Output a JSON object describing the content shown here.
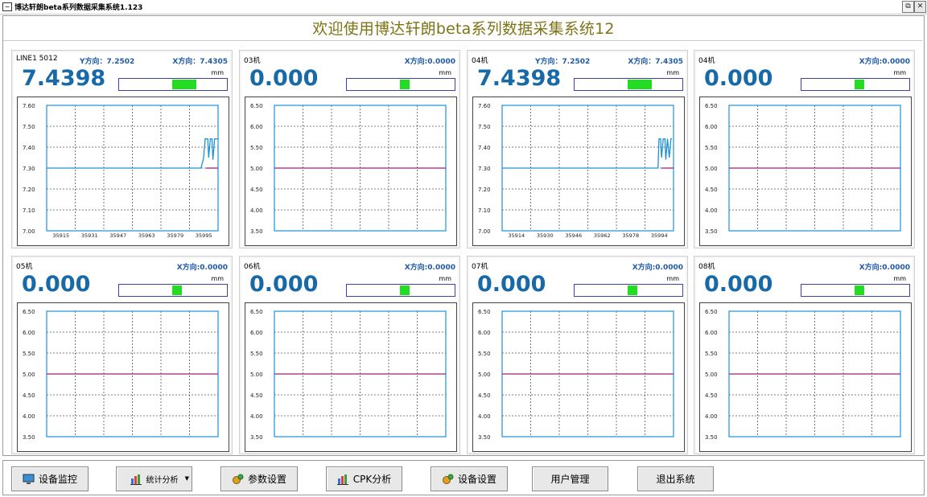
{
  "window": {
    "title": "博达轩朗beta系列数据采集系统1.123",
    "restore_glyph": "⧉",
    "close_glyph": "✕"
  },
  "header": {
    "title": "欢迎使用博达轩朗beta系列数据采集系统12"
  },
  "panels": [
    {
      "name": "LINE1  5012",
      "y_label": "Y方向：7.2502",
      "x_label": "X方向：7.4305",
      "value": "7.4398",
      "unit": "mm",
      "level_from": 0.5,
      "level_to": 0.73,
      "chart_data": {
        "type": "line",
        "y_ticks": [
          "7.60",
          "7.50",
          "7.40",
          "7.30",
          "7.20",
          "7.10",
          "7.00"
        ],
        "x_ticks": [
          "35915",
          "35931",
          "35947",
          "35963",
          "35979",
          "35995"
        ],
        "ylim": [
          7.0,
          7.6
        ],
        "series": [
          {
            "color": "#1e90d8",
            "values": [
              [
                0,
                7.3
              ],
              [
                0.9,
                7.3
              ],
              [
                0.915,
                7.345
              ],
              [
                0.925,
                7.44
              ],
              [
                0.94,
                7.44
              ],
              [
                0.945,
                7.35
              ],
              [
                0.955,
                7.44
              ],
              [
                0.965,
                7.44
              ],
              [
                0.97,
                7.34
              ],
              [
                0.98,
                7.44
              ],
              [
                1.0,
                7.44
              ]
            ]
          },
          {
            "color": "#a0207a",
            "values": [
              [
                0.93,
                7.3
              ],
              [
                1.0,
                7.3
              ]
            ]
          }
        ]
      }
    },
    {
      "name": "03机",
      "y_label": "",
      "x_label": "X方向:0.0000",
      "value": "0.000",
      "unit": "mm",
      "level_from": 0.5,
      "level_to": 0.59,
      "chart_data": {
        "type": "line",
        "y_ticks": [
          "6.50",
          "6.00",
          "5.50",
          "5.00",
          "4.50",
          "4.00",
          "3.50"
        ],
        "x_ticks": [],
        "ylim": [
          3.5,
          6.5
        ],
        "series": [
          {
            "color": "#a0207a",
            "values": [
              [
                0,
                5.0
              ],
              [
                1,
                5.0
              ]
            ]
          }
        ]
      }
    },
    {
      "name": "04机",
      "y_label": "Y方向：7.2502",
      "x_label": "X方向：7.4305",
      "value": "7.4398",
      "unit": "mm",
      "level_from": 0.5,
      "level_to": 0.73,
      "chart_data": {
        "type": "line",
        "y_ticks": [
          "7.60",
          "7.50",
          "7.40",
          "7.30",
          "7.20",
          "7.10",
          "7.00"
        ],
        "x_ticks": [
          "35914",
          "35930",
          "35946",
          "35962",
          "35978",
          "35994"
        ],
        "ylim": [
          7.0,
          7.6
        ],
        "series": [
          {
            "color": "#1e90d8",
            "values": [
              [
                0,
                7.3
              ],
              [
                0.91,
                7.3
              ],
              [
                0.915,
                7.44
              ],
              [
                0.925,
                7.44
              ],
              [
                0.93,
                7.35
              ],
              [
                0.94,
                7.44
              ],
              [
                0.95,
                7.44
              ],
              [
                0.955,
                7.34
              ],
              [
                0.965,
                7.44
              ],
              [
                0.975,
                7.35
              ],
              [
                0.985,
                7.44
              ],
              [
                0.99,
                7.44
              ]
            ]
          },
          {
            "color": "#a0207a",
            "values": [
              [
                0.93,
                7.3
              ],
              [
                1.0,
                7.3
              ]
            ]
          }
        ]
      }
    },
    {
      "name": "04机",
      "y_label": "",
      "x_label": "X方向:0.0000",
      "value": "0.000",
      "unit": "mm",
      "level_from": 0.5,
      "level_to": 0.59,
      "chart_data": {
        "type": "line",
        "y_ticks": [
          "6.50",
          "6.00",
          "5.50",
          "5.00",
          "4.50",
          "4.00",
          "3.50"
        ],
        "x_ticks": [],
        "ylim": [
          3.5,
          6.5
        ],
        "series": [
          {
            "color": "#a0207a",
            "values": [
              [
                0,
                5.0
              ],
              [
                1,
                5.0
              ]
            ]
          }
        ]
      }
    },
    {
      "name": "05机",
      "y_label": "",
      "x_label": "X方向:0.0000",
      "value": "0.000",
      "unit": "mm",
      "level_from": 0.5,
      "level_to": 0.59,
      "chart_data": {
        "type": "line",
        "y_ticks": [
          "6.50",
          "6.00",
          "5.50",
          "5.00",
          "4.50",
          "4.00",
          "3.50"
        ],
        "x_ticks": [],
        "ylim": [
          3.5,
          6.5
        ],
        "series": [
          {
            "color": "#a0207a",
            "values": [
              [
                0,
                5.0
              ],
              [
                1,
                5.0
              ]
            ]
          }
        ]
      }
    },
    {
      "name": "06机",
      "y_label": "",
      "x_label": "X方向:0.0000",
      "value": "0.000",
      "unit": "mm",
      "level_from": 0.5,
      "level_to": 0.59,
      "chart_data": {
        "type": "line",
        "y_ticks": [
          "6.50",
          "6.00",
          "5.50",
          "5.00",
          "4.50",
          "4.00",
          "3.50"
        ],
        "x_ticks": [],
        "ylim": [
          3.5,
          6.5
        ],
        "series": [
          {
            "color": "#a0207a",
            "values": [
              [
                0,
                5.0
              ],
              [
                1,
                5.0
              ]
            ]
          }
        ]
      }
    },
    {
      "name": "07机",
      "y_label": "",
      "x_label": "X方向:0.0000",
      "value": "0.000",
      "unit": "mm",
      "level_from": 0.5,
      "level_to": 0.59,
      "chart_data": {
        "type": "line",
        "y_ticks": [
          "6.50",
          "6.00",
          "5.50",
          "5.00",
          "4.50",
          "4.00",
          "3.50"
        ],
        "x_ticks": [],
        "ylim": [
          3.5,
          6.5
        ],
        "series": [
          {
            "color": "#a0207a",
            "values": [
              [
                0,
                5.0
              ],
              [
                1,
                5.0
              ]
            ]
          }
        ]
      }
    },
    {
      "name": "08机",
      "y_label": "",
      "x_label": "X方向:0.0000",
      "value": "0.000",
      "unit": "mm",
      "level_from": 0.5,
      "level_to": 0.59,
      "chart_data": {
        "type": "line",
        "y_ticks": [
          "6.50",
          "6.00",
          "5.50",
          "5.00",
          "4.50",
          "4.00",
          "3.50"
        ],
        "x_ticks": [],
        "ylim": [
          3.5,
          6.5
        ],
        "series": [
          {
            "color": "#a0207a",
            "values": [
              [
                0,
                5.0
              ],
              [
                1,
                5.0
              ]
            ]
          }
        ]
      }
    }
  ],
  "footer": {
    "buttons": [
      {
        "label": "设备监控",
        "icon": "monitor-icon"
      },
      {
        "label": "统计分析",
        "icon": "bar-chart-icon",
        "dropdown": "▼"
      },
      {
        "label": "参数设置",
        "icon": "gears-icon"
      },
      {
        "label": "CPK分析",
        "icon": "bar-chart-icon"
      },
      {
        "label": "设备设置",
        "icon": "gears-icon"
      },
      {
        "label": "用户管理",
        "icon": ""
      },
      {
        "label": "退出系统",
        "icon": ""
      }
    ]
  }
}
